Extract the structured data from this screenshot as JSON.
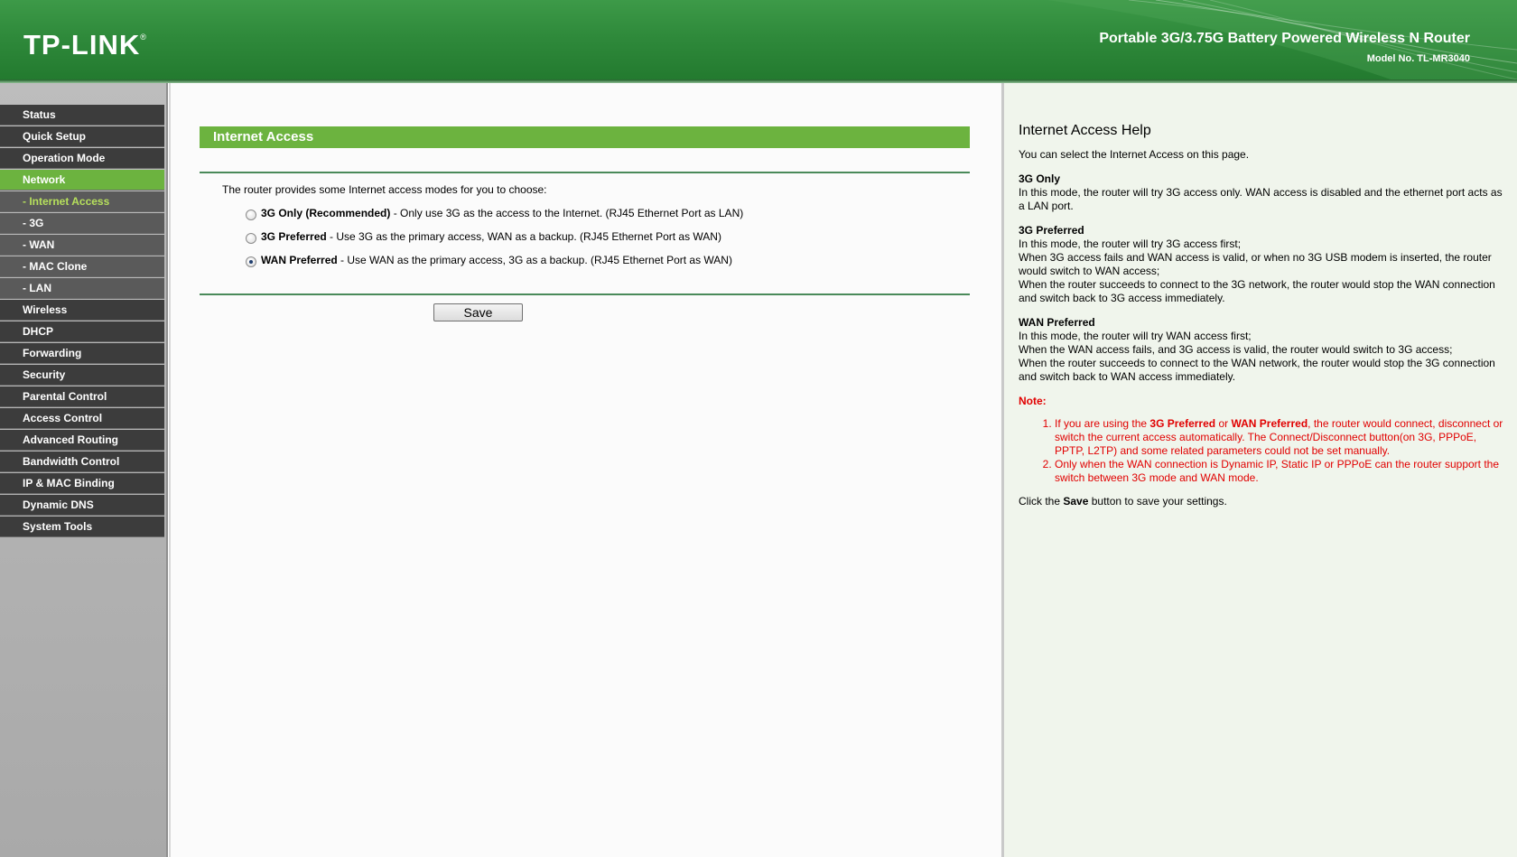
{
  "header": {
    "logo": "TP-LINK",
    "logo_mark": "®",
    "product": "Portable 3G/3.75G Battery Powered Wireless N Router",
    "model": "Model No. TL-MR3040"
  },
  "sidebar": {
    "items": [
      {
        "label": "Status"
      },
      {
        "label": "Quick Setup"
      },
      {
        "label": "Operation Mode"
      },
      {
        "label": "Network"
      },
      {
        "label": "- Internet Access"
      },
      {
        "label": "- 3G"
      },
      {
        "label": "- WAN"
      },
      {
        "label": "- MAC Clone"
      },
      {
        "label": "- LAN"
      },
      {
        "label": "Wireless"
      },
      {
        "label": "DHCP"
      },
      {
        "label": "Forwarding"
      },
      {
        "label": "Security"
      },
      {
        "label": "Parental Control"
      },
      {
        "label": "Access Control"
      },
      {
        "label": "Advanced Routing"
      },
      {
        "label": "Bandwidth Control"
      },
      {
        "label": "IP & MAC Binding"
      },
      {
        "label": "Dynamic DNS"
      },
      {
        "label": "System Tools"
      }
    ]
  },
  "main": {
    "title": "Internet Access",
    "intro": "The router provides some Internet access modes for you to choose:",
    "options": [
      {
        "name": "3G Only (Recommended)",
        "desc": " - Only use 3G as the access to the Internet.  (RJ45 Ethernet Port as LAN)"
      },
      {
        "name": "3G Preferred",
        "desc": " - Use 3G as the primary access, WAN as a backup.  (RJ45 Ethernet Port as WAN)"
      },
      {
        "name": "WAN Preferred",
        "desc": " - Use WAN as the primary access, 3G as a backup.  (RJ45 Ethernet Port as WAN)"
      }
    ],
    "selected_option": "WAN Preferred",
    "save_label": "Save"
  },
  "help": {
    "title": "Internet Access Help",
    "intro": "You can select the Internet Access on this page.",
    "s1_title": "3G Only",
    "s1_text": "In this mode, the router will try 3G access only. WAN access is disabled and the ethernet port acts as a LAN port.",
    "s2_title": "3G Preferred",
    "s2_line1": "In this mode, the router will try 3G access first;",
    "s2_line2": "When 3G access fails and WAN access is valid, or when no 3G USB modem is inserted, the router would switch to WAN access;",
    "s2_line3": "When the router succeeds to connect to the 3G network, the router would stop the WAN connection and switch back to 3G access immediately.",
    "s3_title": "WAN Preferred",
    "s3_line1": "In this mode, the router will try WAN access first;",
    "s3_line2": "When the WAN access fails, and 3G access is valid, the router would switch to 3G access;",
    "s3_line3": "When the router succeeds to connect to the WAN network, the router would stop the 3G connection and switch back to WAN access immediately.",
    "note_title": "Note:",
    "note1_pre": "If you are using the ",
    "note1_b1": "3G Preferred",
    "note1_mid": " or ",
    "note1_b2": "WAN Preferred",
    "note1_post": ", the router would connect, disconnect or switch the current access automatically. The Connect/Disconnect button(on 3G, PPPoE, PPTP, L2TP) and some related parameters could not be set manually.",
    "note2": "Only when the WAN connection is Dynamic IP, Static IP or PPPoE can the router support the switch between 3G mode and WAN mode.",
    "save_pre": "Click the ",
    "save_b": "Save",
    "save_post": " button to save your settings."
  },
  "colors": {
    "header_green": "#2f8a3b",
    "menu_active": "#6cb33f",
    "menu_dark": "#3c3c3c",
    "submenu_selected_text": "#b6e05c",
    "note_red": "#e10000"
  }
}
